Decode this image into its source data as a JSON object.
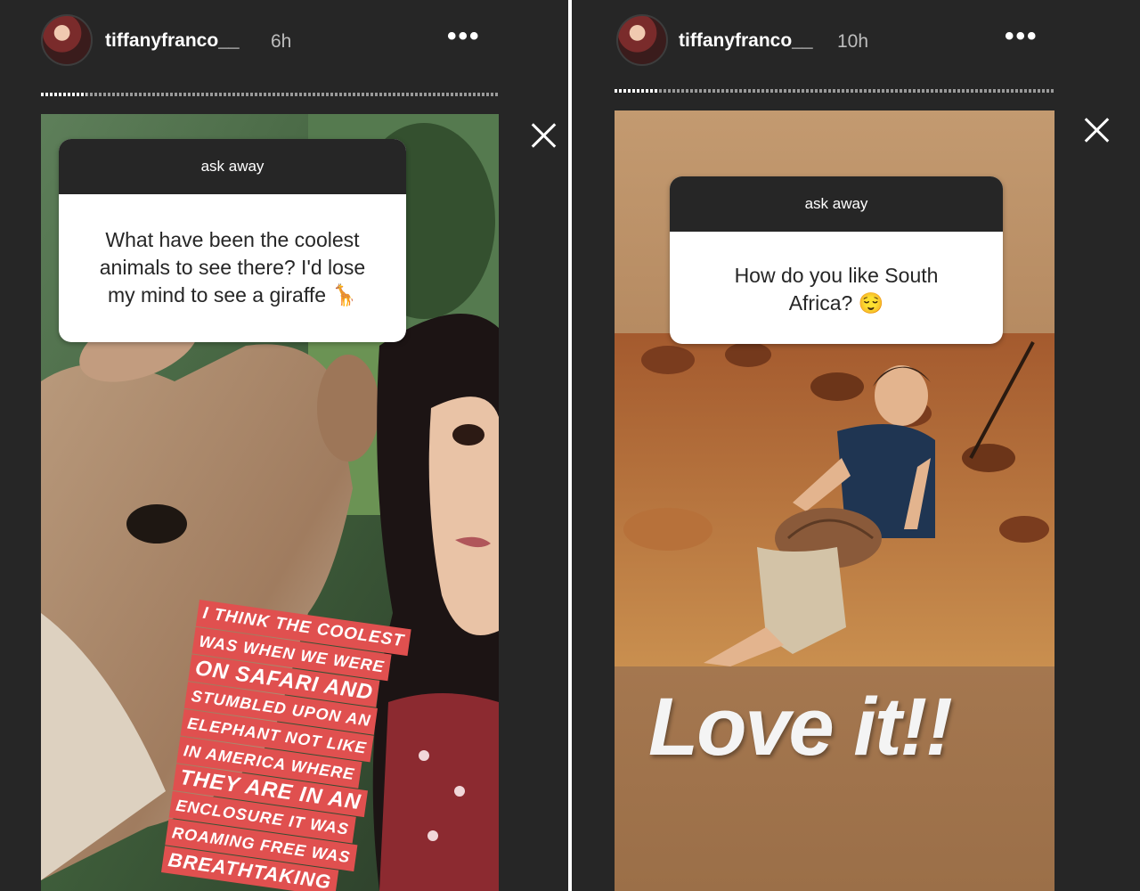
{
  "stories": [
    {
      "username": "tiffanyfranco__",
      "time_ago": "6h",
      "more_label": "•••",
      "question_header": "ask away",
      "question_lines": [
        "What have been the coolest",
        "animals to see there? I'd lose",
        "my mind to see a giraffe 🦒"
      ],
      "answer_lines": [
        "I THINK THE COOLEST",
        "WAS WHEN WE WERE",
        "ON SAFARI AND",
        "STUMBLED UPON AN",
        "ELEPHANT NOT LIKE",
        "IN AMERICA WHERE",
        "THEY ARE IN AN",
        "ENCLOSURE IT WAS",
        "ROAMING FREE WAS",
        "BREATHTAKING"
      ],
      "progress_fraction": 0.1
    },
    {
      "username": "tiffanyfranco__",
      "time_ago": "10h",
      "more_label": "•••",
      "question_header": "ask away",
      "question_lines": [
        "How do you like South",
        "Africa? 😌"
      ],
      "answer_text": "Love it!!",
      "progress_fraction": 0.1
    }
  ],
  "colors": {
    "panel_bg": "#262626",
    "answer_highlight": "#e0504f",
    "story_bg_brown": "#a87a52"
  },
  "icons": [
    "avatar",
    "more-options-icon",
    "close-icon"
  ]
}
